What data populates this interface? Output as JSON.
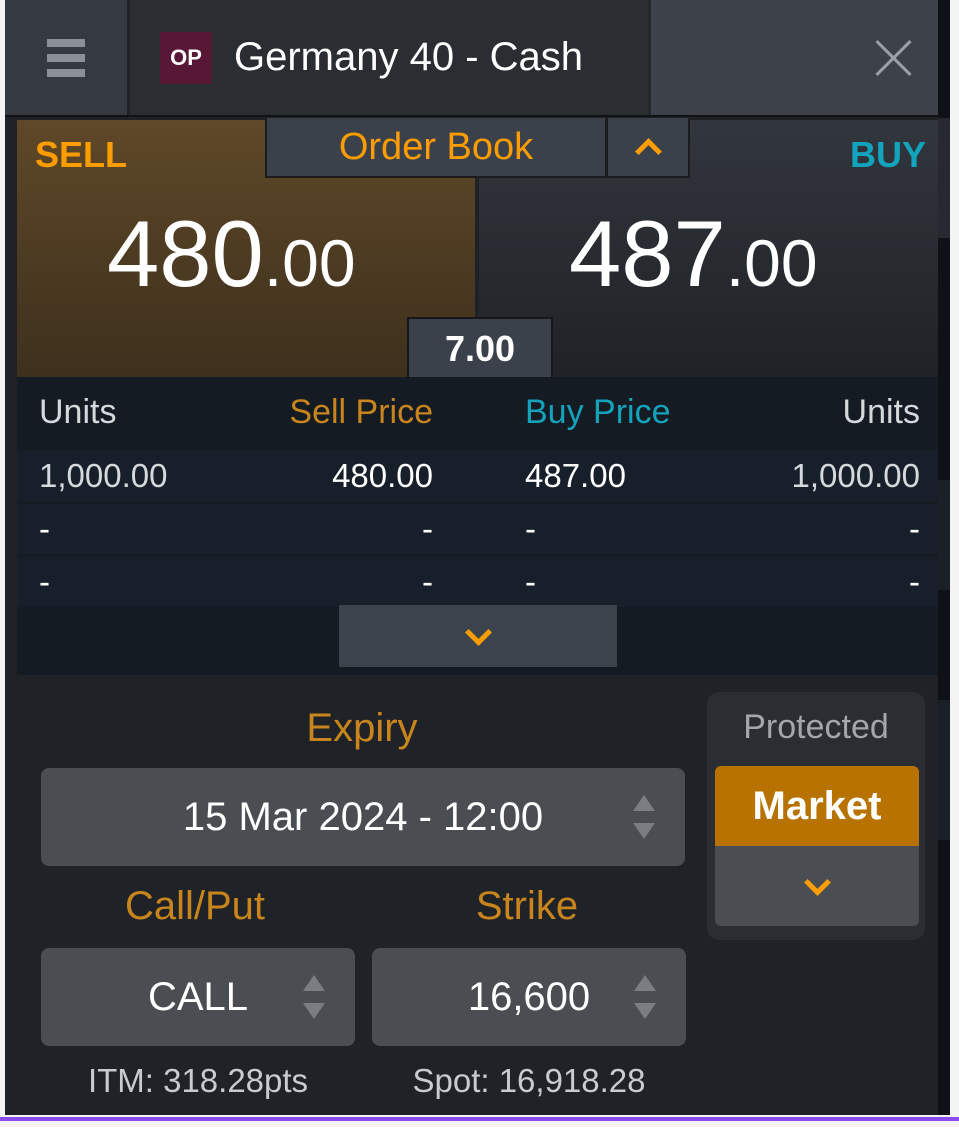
{
  "header": {
    "menu_icon": "hamburger-menu-icon",
    "instrument_badge": "OP",
    "title": "Germany 40 - Cash",
    "close_icon": "close-icon"
  },
  "prices": {
    "sell_label": "SELL",
    "buy_label": "BUY",
    "sell_big": "480",
    "sell_small": ".00",
    "buy_big": "487",
    "buy_small": ".00",
    "spread": "7.00",
    "order_book_label": "Order Book",
    "order_book_toggle_icon": "chevron-up-icon"
  },
  "order_book": {
    "columns": [
      "Units",
      "Sell Price",
      "Buy Price",
      "Units"
    ],
    "rows": [
      [
        "1,000.00",
        "480.00",
        "487.00",
        "1,000.00"
      ],
      [
        "-",
        "-",
        "-",
        "-"
      ],
      [
        "-",
        "-",
        "-",
        "-"
      ]
    ],
    "expand_icon": "chevron-down-icon"
  },
  "form": {
    "expiry_label": "Expiry",
    "expiry_value": "15 Mar 2024 - 12:00",
    "callput_label": "Call/Put",
    "callput_value": "CALL",
    "strike_label": "Strike",
    "strike_value": "16,600",
    "itm_text": "ITM: 318.28pts",
    "spot_text": "Spot: 16,918.28",
    "protected_label": "Protected",
    "order_type": "Market"
  },
  "colors": {
    "sell_accent": "#ff9d00",
    "buy_accent": "#12a4bd",
    "market_button": "#b87200",
    "badge": "#571735"
  }
}
